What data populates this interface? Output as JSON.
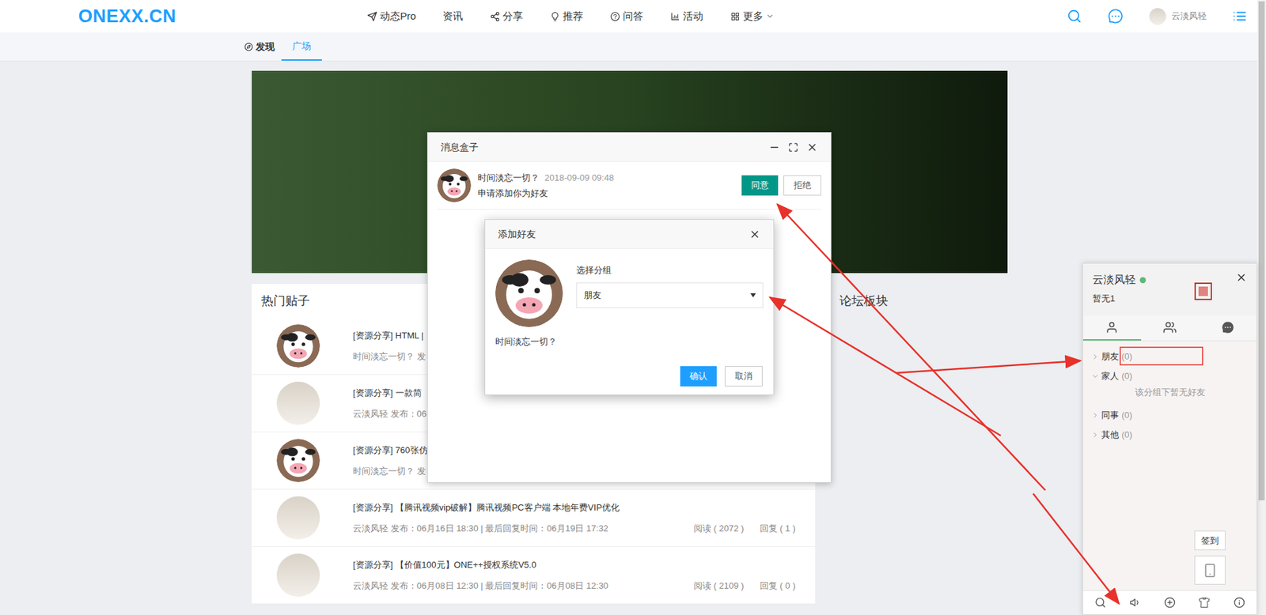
{
  "nav": {
    "logo": "ONEXX.CN",
    "items": [
      {
        "label": "动态Pro"
      },
      {
        "label": "资讯"
      },
      {
        "label": "分享"
      },
      {
        "label": "推荐"
      },
      {
        "label": "问答"
      },
      {
        "label": "活动"
      },
      {
        "label": "更多"
      }
    ],
    "user": "云淡风轻"
  },
  "subnav": {
    "title": "发现",
    "tabs": [
      {
        "label": "广场",
        "selected": true
      }
    ]
  },
  "hot_posts": {
    "title": "热门贴子",
    "rows": [
      {
        "kind": "cow",
        "title": "[资源分享] HTML |",
        "meta": "时间淡忘一切？ 发",
        "reads": "",
        "replies": ""
      },
      {
        "kind": "photo",
        "title": "[资源分享] 一款简",
        "meta": "云淡风轻 发布：06",
        "reads": "",
        "replies": ""
      },
      {
        "kind": "cow",
        "title": "[资源分享] 760张仿",
        "meta": "时间淡忘一切？ 发",
        "reads": "",
        "replies": ""
      },
      {
        "kind": "photo",
        "title": "[资源分享] 【腾讯视频vip破解】腾讯视频PC客户端 本地年费VIP优化",
        "meta": "云淡风轻 发布：06月16日 18:30 | 最后回复时间：06月19日 17:32",
        "reads": "阅读 ( 2072 )",
        "replies": "回复 ( 1 )"
      },
      {
        "kind": "photo",
        "title": "[资源分享] 【价值100元】ONE++授权系统V5.0",
        "meta": "云淡风轻 发布：06月08日 12:30 | 最后回复时间：06月08日 12:30",
        "reads": "阅读 ( 2109 )",
        "replies": "回复 ( 0 )"
      }
    ]
  },
  "forum": {
    "title": "论坛板块"
  },
  "message_box": {
    "title": "消息盒子",
    "items": [
      {
        "name": "时间淡忘一切？",
        "time": "2018-09-09 09:48",
        "text": "申请添加你为好友",
        "accept": "同意",
        "reject": "拒绝"
      }
    ]
  },
  "add_friend": {
    "title": "添加好友",
    "name": "时间淡忘一切？",
    "label": "选择分组",
    "value": "朋友",
    "confirm": "确认",
    "cancel": "取消"
  },
  "im_panel": {
    "user": "云淡风轻",
    "online": true,
    "sign": "暂无1",
    "tabs": [
      {
        "kind": "friends",
        "selected": true
      },
      {
        "kind": "groups",
        "selected": false
      },
      {
        "kind": "chats",
        "selected": false
      }
    ],
    "groups": [
      {
        "name": "朋友",
        "count": "(0)",
        "expanded": false,
        "empty": ""
      },
      {
        "name": "家人",
        "count": "(0)",
        "expanded": true,
        "empty": "该分组下暂无好友"
      },
      {
        "name": "同事",
        "count": "(0)",
        "expanded": false,
        "empty": ""
      },
      {
        "name": "其他",
        "count": "(0)",
        "expanded": false,
        "empty": ""
      }
    ],
    "sign_in": "签到"
  }
}
